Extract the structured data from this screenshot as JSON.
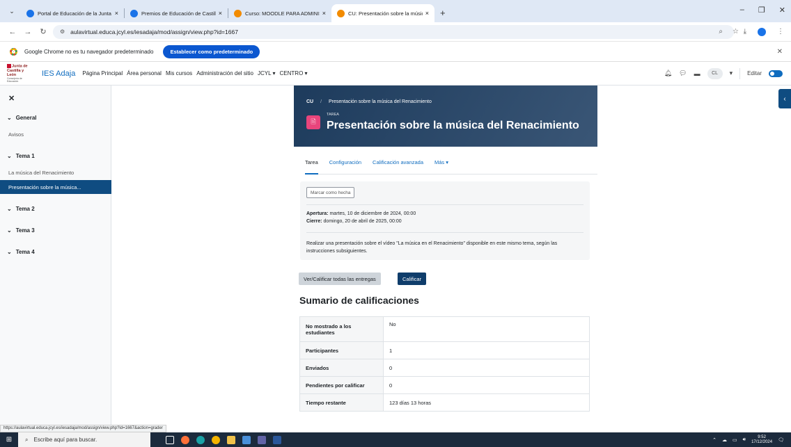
{
  "browser": {
    "tabs": [
      {
        "title": "Portal de Educación de la Junta",
        "color": "#1a73e8"
      },
      {
        "title": "Premios de Educación de Castilla",
        "color": "#1a73e8"
      },
      {
        "title": "Curso: MOODLE PARA ADMINIS",
        "color": "#f28b00"
      },
      {
        "title": "CU: Presentación sobre la músic",
        "color": "#f28b00"
      }
    ],
    "url": "aulavirtual.educa.jcyl.es/iesadaja/mod/assign/view.php?id=1667",
    "infobar_text": "Google Chrome no es tu navegador predeterminado",
    "infobar_button": "Establecer como predeterminado"
  },
  "moodle_nav": {
    "logo_line1": "Junta de",
    "logo_line2": "Castilla y León",
    "logo_line3": "Consejería de Educación",
    "site_name": "IES Adaja",
    "links": [
      "Página Principal",
      "Área personal",
      "Mis cursos",
      "Administración del sitio",
      "JCYL ▾",
      "CENTRO ▾"
    ],
    "avatar": "CL",
    "edit_label": "Editar"
  },
  "sidebar": {
    "sections": [
      {
        "title": "General",
        "items": [
          "Avisos"
        ]
      },
      {
        "title": "Tema 1",
        "items": [
          "La música del Renacimiento",
          "Presentación sobre la música..."
        ]
      },
      {
        "title": "Tema 2",
        "items": []
      },
      {
        "title": "Tema 3",
        "items": []
      },
      {
        "title": "Tema 4",
        "items": []
      }
    ]
  },
  "header": {
    "breadcrumb_course": "CU",
    "breadcrumb_activity": "Presentación sobre la música del Renacimiento",
    "activity_type": "TAREA",
    "title": "Presentación sobre la música del Renacimiento"
  },
  "tabs": [
    "Tarea",
    "Configuración",
    "Calificación avanzada",
    "Más ▾"
  ],
  "activity": {
    "mark_done": "Marcar como hecha",
    "open_label": "Apertura:",
    "open_value": "martes, 10 de diciembre de 2024, 00:00",
    "close_label": "Cierre:",
    "close_value": "domingo, 20 de abril de 2025, 00:00",
    "description": "Realizar una presentación sobre el vídeo \"La música en el Renacimiento\" disponible en este mismo tema, según las instrucciones subsiguientes."
  },
  "buttons": {
    "view_all": "Ver/Calificar todas las entregas",
    "grade": "Calificar"
  },
  "summary": {
    "heading": "Sumario de calificaciones",
    "rows": [
      {
        "label": "No mostrado a los estudiantes",
        "value": "No"
      },
      {
        "label": "Participantes",
        "value": "1"
      },
      {
        "label": "Enviados",
        "value": "0"
      },
      {
        "label": "Pendientes por calificar",
        "value": "0"
      },
      {
        "label": "Tiempo restante",
        "value": "123 días 13 horas"
      }
    ]
  },
  "status_url": "https://aulavirtual.educa.jcyl.es/iesadaja/mod/assign/view.php?id=1667&action=grader",
  "taskbar": {
    "search_placeholder": "Escribe aquí para buscar.",
    "time": "9:52",
    "date": "17/12/2024"
  }
}
